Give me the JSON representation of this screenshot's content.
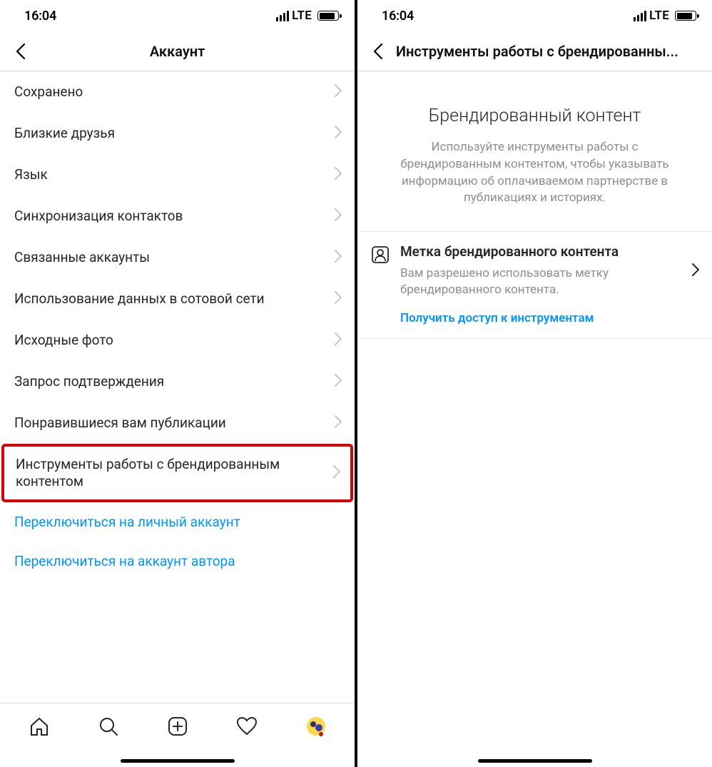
{
  "status": {
    "time": "16:04",
    "network_label": "LTE"
  },
  "left": {
    "header_title": "Аккаунт",
    "rows": [
      {
        "label": "Сохранено"
      },
      {
        "label": "Близкие друзья"
      },
      {
        "label": "Язык"
      },
      {
        "label": "Синхронизация контактов"
      },
      {
        "label": "Связанные аккаунты"
      },
      {
        "label": "Использование данных в сотовой сети"
      },
      {
        "label": "Исходные фото"
      },
      {
        "label": "Запрос подтверждения"
      },
      {
        "label": "Понравившиеся вам публикации"
      },
      {
        "label": "Инструменты работы с брендированным контентом",
        "highlight": true
      }
    ],
    "links": [
      "Переключиться на личный аккаунт",
      "Переключиться на аккаунт автора"
    ]
  },
  "right": {
    "header_title": "Инструменты работы с брендированным контентом",
    "hero_title": "Брендированный контент",
    "hero_desc": "Используйте инструменты работы с брендированным контентом, чтобы указывать информацию об оплачиваемом партнерстве в публикациях и историях.",
    "item_title": "Метка брендированного контента",
    "item_desc": "Вам разрешено использовать метку брендированного контента.",
    "item_link": "Получить доступ к инструментам"
  }
}
